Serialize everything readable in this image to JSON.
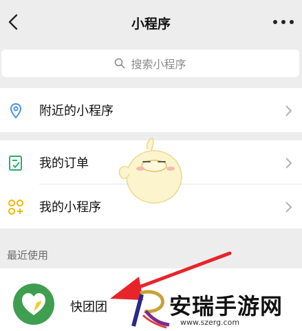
{
  "navbar": {
    "title": "小程序",
    "back_icon": "chevron-left-icon",
    "more_icon": "more-dots-icon"
  },
  "search": {
    "placeholder": "搜索小程序",
    "icon": "search-icon"
  },
  "menu": [
    {
      "label": "附近的小程序",
      "icon": "location-pin-icon",
      "icon_color": "#4a90e2"
    },
    {
      "label": "我的订单",
      "icon": "order-list-icon",
      "icon_color": "#2aae67"
    },
    {
      "label": "我的小程序",
      "icon": "mini-program-icon",
      "icon_color": "#f2b600"
    }
  ],
  "recent": {
    "section_title": "最近使用",
    "apps": [
      {
        "name": "快团团",
        "icon": "kuaituantuan-app-icon",
        "icon_color": "#3f9e50"
      }
    ]
  },
  "annotation": {
    "arrow_color": "#e8242b"
  },
  "watermark": {
    "text": "安瑞手游网",
    "url": "www.szerg.com"
  }
}
